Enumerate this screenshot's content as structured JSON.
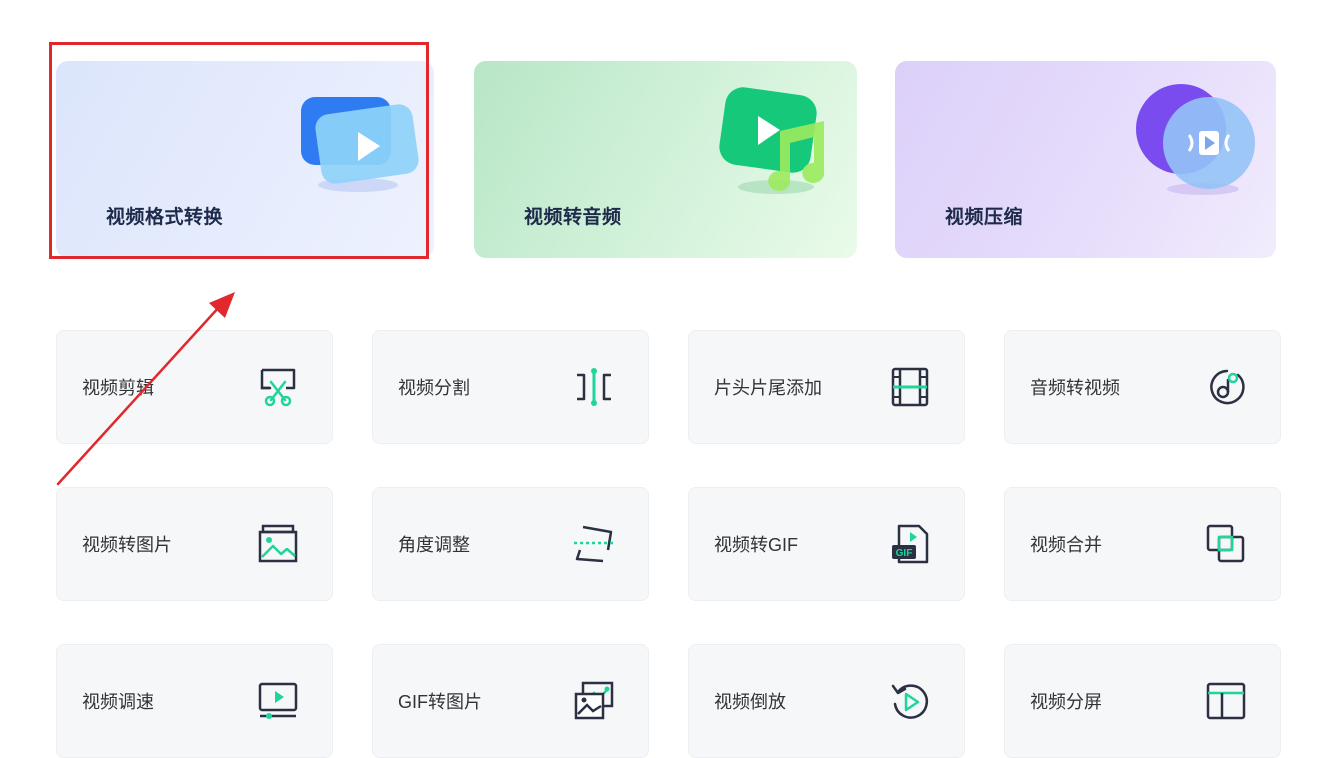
{
  "features": [
    {
      "label": "视频格式转换"
    },
    {
      "label": "视频转音频"
    },
    {
      "label": "视频压缩"
    }
  ],
  "tools": [
    {
      "label": "视频剪辑",
      "icon": "scissors-screen-icon"
    },
    {
      "label": "视频分割",
      "icon": "split-icon"
    },
    {
      "label": "片头片尾添加",
      "icon": "film-strip-icon"
    },
    {
      "label": "音频转视频",
      "icon": "music-note-circle-icon"
    },
    {
      "label": "视频转图片",
      "icon": "image-icon"
    },
    {
      "label": "角度调整",
      "icon": "rotate-frame-icon"
    },
    {
      "label": "视频转GIF",
      "icon": "gif-file-icon"
    },
    {
      "label": "视频合并",
      "icon": "merge-squares-icon"
    },
    {
      "label": "视频调速",
      "icon": "speed-player-icon"
    },
    {
      "label": "GIF转图片",
      "icon": "images-stack-icon"
    },
    {
      "label": "视频倒放",
      "icon": "reverse-play-icon"
    },
    {
      "label": "视频分屏",
      "icon": "split-screen-icon"
    }
  ],
  "colors": {
    "accent": "#1fd59a",
    "icon_dark": "#2b3042",
    "highlight": "#e0282d"
  }
}
